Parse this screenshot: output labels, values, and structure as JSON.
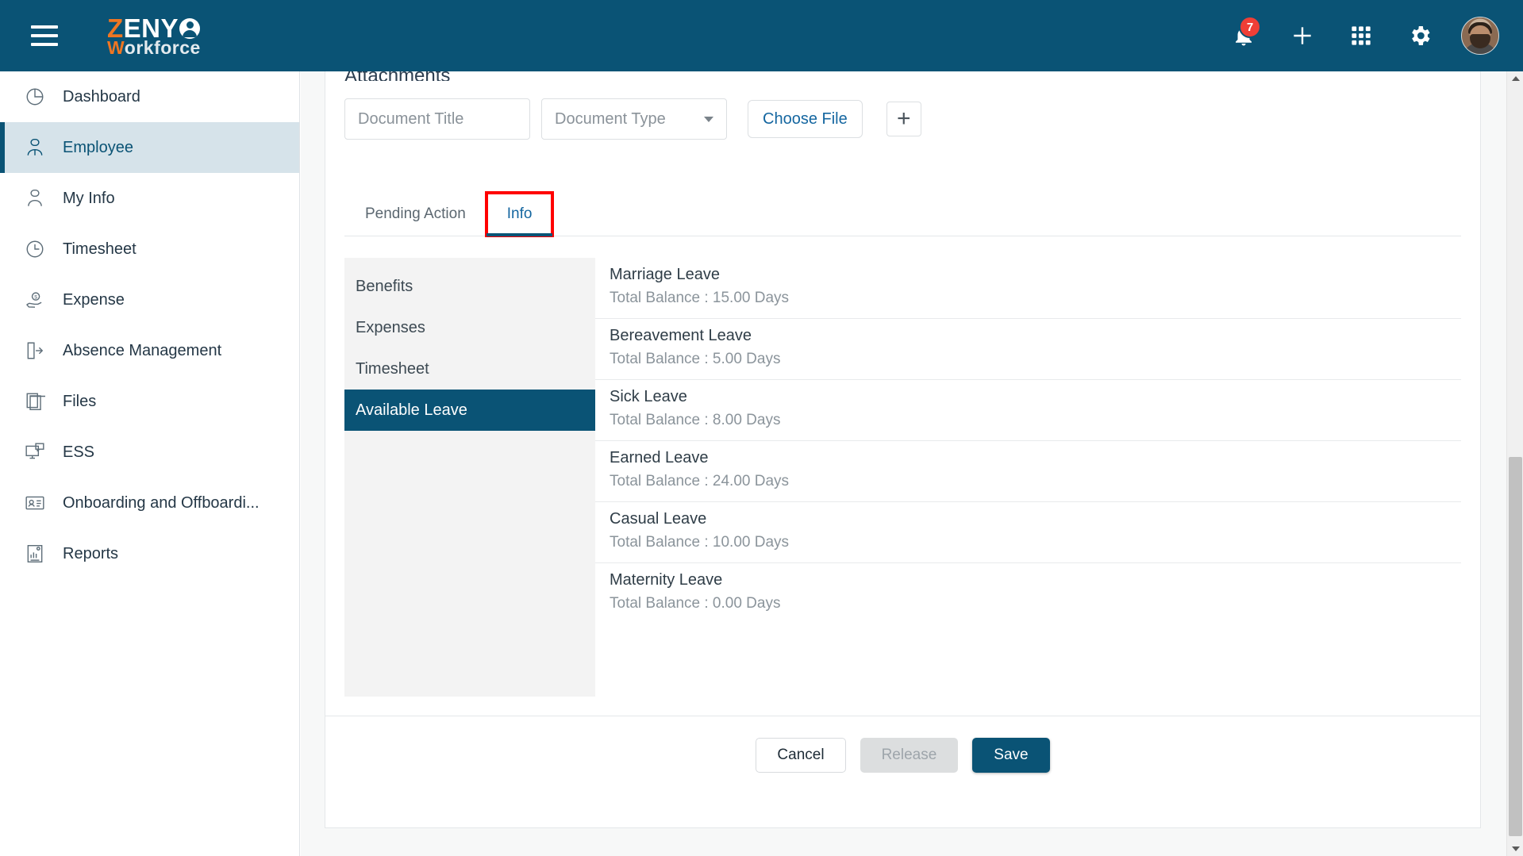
{
  "header": {
    "menu_icon": "hamburger-menu-icon",
    "logo": {
      "brand_1": "Z",
      "brand_2": "ENY",
      "brand_3": "Workforce",
      "brand_3_first": "W",
      "brand_3_rest": "orkforce"
    },
    "notification_count": "7",
    "icons": [
      "bell-icon",
      "plus-icon",
      "apps-grid-icon",
      "gear-icon",
      "avatar"
    ],
    "colors": {
      "bar": "#0a5375",
      "accent_orange": "#ef7622",
      "badge_red": "#ef3e36"
    }
  },
  "sidebar": {
    "items": [
      {
        "label": "Dashboard",
        "icon": "pie-chart-icon",
        "active": false
      },
      {
        "label": "Employee",
        "icon": "employee-icon",
        "active": true
      },
      {
        "label": "My Info",
        "icon": "person-info-icon",
        "active": false
      },
      {
        "label": "Timesheet",
        "icon": "clock-icon",
        "active": false
      },
      {
        "label": "Expense",
        "icon": "money-hand-icon",
        "active": false
      },
      {
        "label": "Absence Management",
        "icon": "exit-door-icon",
        "active": false
      },
      {
        "label": "Files",
        "icon": "documents-icon",
        "active": false
      },
      {
        "label": "ESS",
        "icon": "monitor-chat-icon",
        "active": false
      },
      {
        "label": "Onboarding and Offboardi...",
        "icon": "id-card-icon",
        "active": false
      },
      {
        "label": "Reports",
        "icon": "report-icon",
        "active": false
      }
    ]
  },
  "main": {
    "section_title": "Attachments",
    "attachments": {
      "document_title_placeholder": "Document Title",
      "document_type_placeholder": "Document Type",
      "choose_file_label": "Choose File",
      "add_label": "+"
    },
    "tabs": [
      {
        "label": "Pending Action",
        "active": false,
        "highlighted": false
      },
      {
        "label": "Info",
        "active": true,
        "highlighted": true
      }
    ],
    "subnav": [
      {
        "label": "Benefits",
        "active": false
      },
      {
        "label": "Expenses",
        "active": false
      },
      {
        "label": "Timesheet",
        "active": false
      },
      {
        "label": "Available Leave",
        "active": true
      }
    ],
    "leave_balances": [
      {
        "name": "Marriage Leave",
        "balance": "Total Balance : 15.00 Days"
      },
      {
        "name": "Bereavement Leave",
        "balance": "Total Balance : 5.00 Days"
      },
      {
        "name": "Sick Leave",
        "balance": "Total Balance : 8.00 Days"
      },
      {
        "name": "Earned Leave",
        "balance": "Total Balance : 24.00 Days"
      },
      {
        "name": "Casual Leave",
        "balance": "Total Balance : 10.00 Days"
      },
      {
        "name": "Maternity Leave",
        "balance": "Total Balance : 0.00 Days"
      }
    ],
    "footer": {
      "cancel_label": "Cancel",
      "release_label": "Release",
      "save_label": "Save"
    }
  }
}
